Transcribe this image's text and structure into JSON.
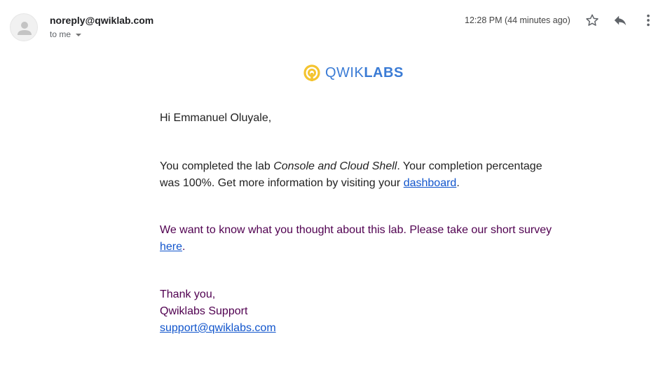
{
  "header": {
    "sender": "noreply@qwiklab.com",
    "recipient": "to me",
    "timestamp": "12:28 PM (44 minutes ago)",
    "icons": [
      "person-icon",
      "star-icon",
      "reply-icon",
      "more-vert-icon",
      "chevron-down-icon"
    ]
  },
  "logo": {
    "text_light": "QWIK",
    "text_bold": "LABS",
    "colors": {
      "mark": "#f4c430",
      "text": "#3a7bd5"
    }
  },
  "email": {
    "greeting": "Hi Emmanuel Oluyale,",
    "completion_pre": "You completed the lab ",
    "lab_name": "Console and Cloud Shell",
    "completion_mid": ". Your completion percentage was 100%. Get more information by visiting your ",
    "dashboard_link": "dashboard",
    "completion_end": ".",
    "survey_pre": "We want to know what you thought about this lab. Please take our short survey ",
    "survey_link": "here",
    "survey_end": ".",
    "thanks": "Thank you,",
    "signature": "Qwiklabs Support",
    "support_email": "support@qwiklabs.com"
  },
  "colors": {
    "link": "#1155cc",
    "quoted_text": "#500050"
  }
}
